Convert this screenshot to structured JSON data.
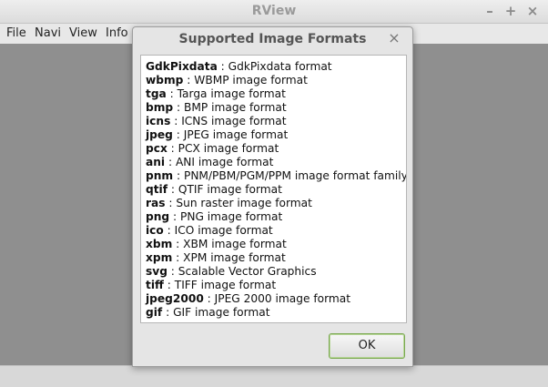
{
  "window": {
    "title": "RView",
    "minimize_glyph": "–",
    "maximize_glyph": "+",
    "close_glyph": "×"
  },
  "menubar": {
    "items": [
      {
        "label": "File"
      },
      {
        "label": "Navi"
      },
      {
        "label": "View"
      },
      {
        "label": "Info"
      }
    ]
  },
  "dialog": {
    "title": "Supported Image Formats",
    "close_glyph": "×",
    "ok_label": "OK",
    "formats": [
      {
        "name": "GdkPixdata",
        "desc": " : GdkPixdata format"
      },
      {
        "name": "wbmp",
        "desc": " : WBMP image format"
      },
      {
        "name": "tga",
        "desc": " : Targa image format"
      },
      {
        "name": "bmp",
        "desc": " : BMP image format"
      },
      {
        "name": "icns",
        "desc": " : ICNS image format"
      },
      {
        "name": "jpeg",
        "desc": " : JPEG image format"
      },
      {
        "name": "pcx",
        "desc": " : PCX image format"
      },
      {
        "name": "ani",
        "desc": " : ANI image format"
      },
      {
        "name": "pnm",
        "desc": " : PNM/PBM/PGM/PPM image format family"
      },
      {
        "name": "qtif",
        "desc": " : QTIF image format"
      },
      {
        "name": "ras",
        "desc": " : Sun raster image format"
      },
      {
        "name": "png",
        "desc": " : PNG image format"
      },
      {
        "name": "ico",
        "desc": " : ICO image format"
      },
      {
        "name": "xbm",
        "desc": " : XBM image format"
      },
      {
        "name": "xpm",
        "desc": " : XPM image format"
      },
      {
        "name": "svg",
        "desc": " : Scalable Vector Graphics"
      },
      {
        "name": "tiff",
        "desc": " : TIFF image format"
      },
      {
        "name": "jpeg2000",
        "desc": " : JPEG 2000 image format"
      },
      {
        "name": "gif",
        "desc": " : GIF image format"
      }
    ]
  },
  "colors": {
    "canvas": "#8f8f8f",
    "ok_border": "#7aa84f"
  }
}
